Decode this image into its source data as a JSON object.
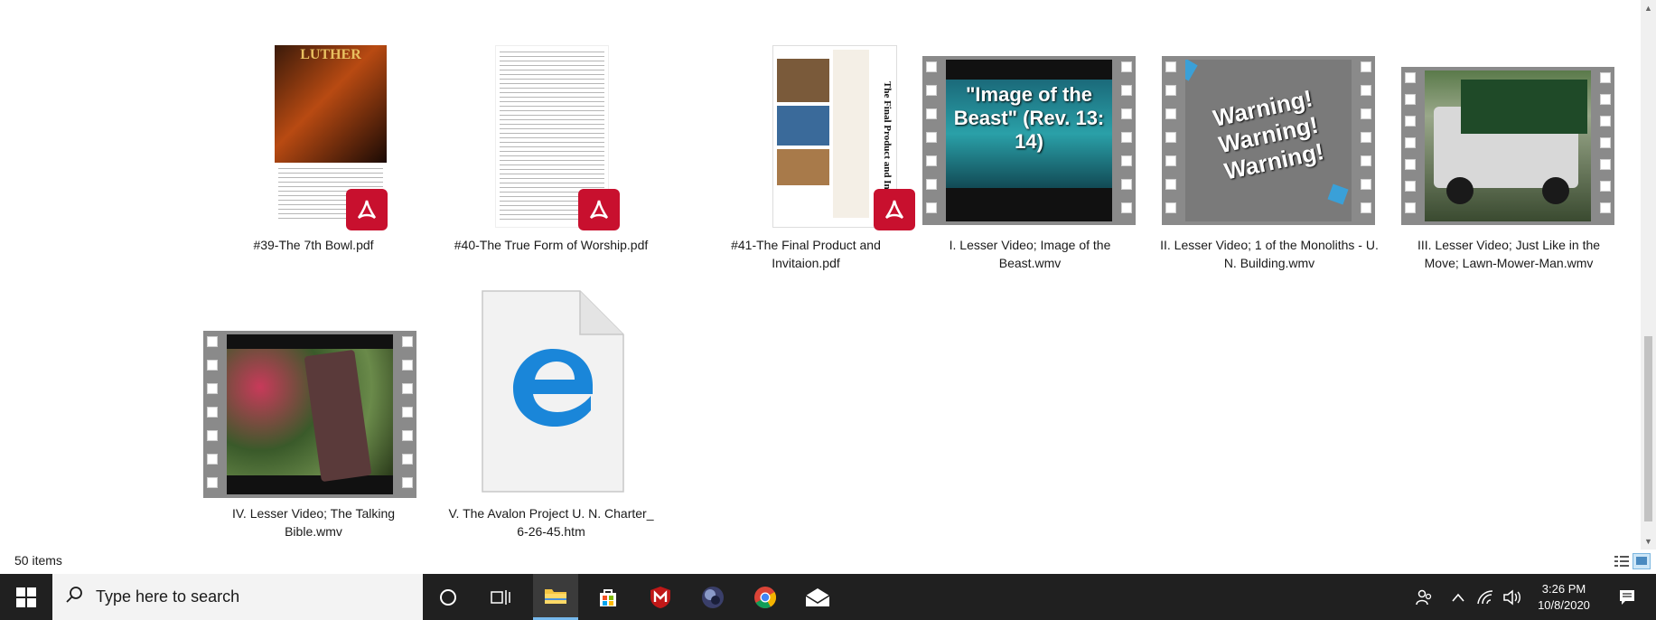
{
  "files": [
    {
      "name": "#39-The 7th Bowl.pdf",
      "type": "pdf",
      "preview_title": "LUTHER"
    },
    {
      "name": "#40-The True Form of Worship.pdf",
      "type": "pdf"
    },
    {
      "name": "#41-The Final Product and Invitaion.pdf",
      "type": "pdf",
      "preview_title": "The Final Product and In"
    },
    {
      "name": "I. Lesser Video; Image of the Beast.wmv",
      "type": "video",
      "preview_text": "\"Image of the Beast\" (Rev. 13: 14)"
    },
    {
      "name": "II. Lesser Video; 1 of the Monoliths - U. N. Building.wmv",
      "type": "video",
      "preview_text": "Warning! Warning! Warning!"
    },
    {
      "name": "III. Lesser Video; Just Like in the Move; Lawn-Mower-Man.wmv",
      "type": "video"
    },
    {
      "name": "IV. Lesser Video; The Talking Bible.wmv",
      "type": "video"
    },
    {
      "name": "V. The Avalon Project U. N. Charter_ 6-26-45.htm",
      "type": "htm",
      "icon": "edge-icon"
    }
  ],
  "status": {
    "item_count": "50 items"
  },
  "taskbar": {
    "search_placeholder": "Type here to search",
    "time": "3:26 PM",
    "date": "10/8/2020"
  },
  "colors": {
    "pdf_badge": "#c8102e",
    "taskbar": "#202020",
    "edge_blue": "#1a86d9"
  }
}
